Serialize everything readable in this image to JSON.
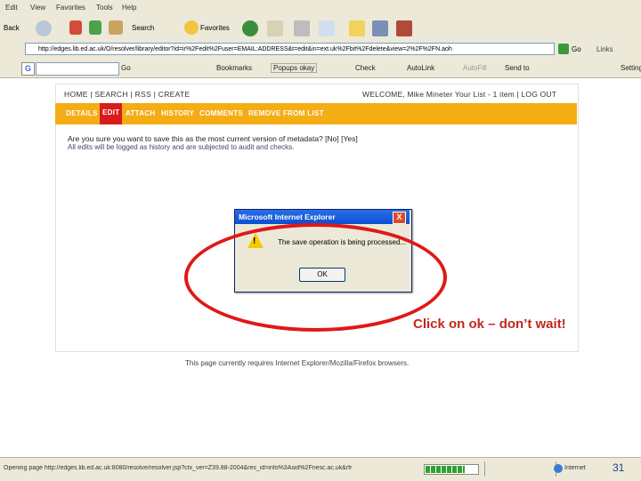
{
  "menu": [
    "Edit",
    "View",
    "Favorites",
    "Tools",
    "Help"
  ],
  "toolbar": {
    "back_label": "Back",
    "search_label": "Search",
    "favorites_label": "Favorites"
  },
  "address": {
    "url": "http://edges.lib.ed.ac.uk/O/resolver/library/editor?id=ir%2Fedit%2Fuser=EMAIL:ADDRESS&t=edit&in=ext.uk%2Fbit%2Fdelete&view=2%2F%2FN.aoh",
    "go_label": "Go",
    "links_label": "Links"
  },
  "google_bar": {
    "go_label": "Go",
    "bookmarks_label": "Bookmarks",
    "popups_label": "Popups okay",
    "check_label": "Check",
    "autolink_label": "AutoLink",
    "autofill_label": "AutoFill",
    "sendto_label": "Send to",
    "settings_label": "Settings"
  },
  "site": {
    "top_nav": "HOME | SEARCH | RSS | CREATE",
    "welcome": "WELCOME, Mike Mineter   Your List - 1 item | LOG OUT",
    "tabs": [
      "DETAILS",
      "EDIT",
      "ATTACH",
      "HISTORY",
      "COMMENTS",
      "REMOVE FROM LIST"
    ],
    "active_tab": "EDIT",
    "confirm_text": "Are you sure you want to save this as the most current version of metadata? [No] [Yes]",
    "confirm_note": "All edits will be logged as history and are subjected to audit and checks.",
    "footnote": "This page currently requires Internet Explorer/Mozilla/Firefox browsers."
  },
  "dialog": {
    "title": "Microsoft Internet Explorer",
    "close_label": "X",
    "message": "The save operation is being processed...",
    "ok_label": "OK",
    "warn_mark": "!"
  },
  "annotation": {
    "text": "Click on ok – don’t wait!",
    "color": "#e01818"
  },
  "status": {
    "text": "Opening page http://edges.lib.ed.ac.uk:8080/resolve/resolver.jsp?ctx_ver=Z39.88-2004&res_id=info%3Asid%2Fnesc.ac.uk&rfr",
    "progress": 0.75,
    "zone": "Internet",
    "page_number": "31"
  },
  "colors": {
    "accent": "#f4ad14",
    "active_tab": "#d81b1b",
    "annotation": "#c0281c"
  }
}
